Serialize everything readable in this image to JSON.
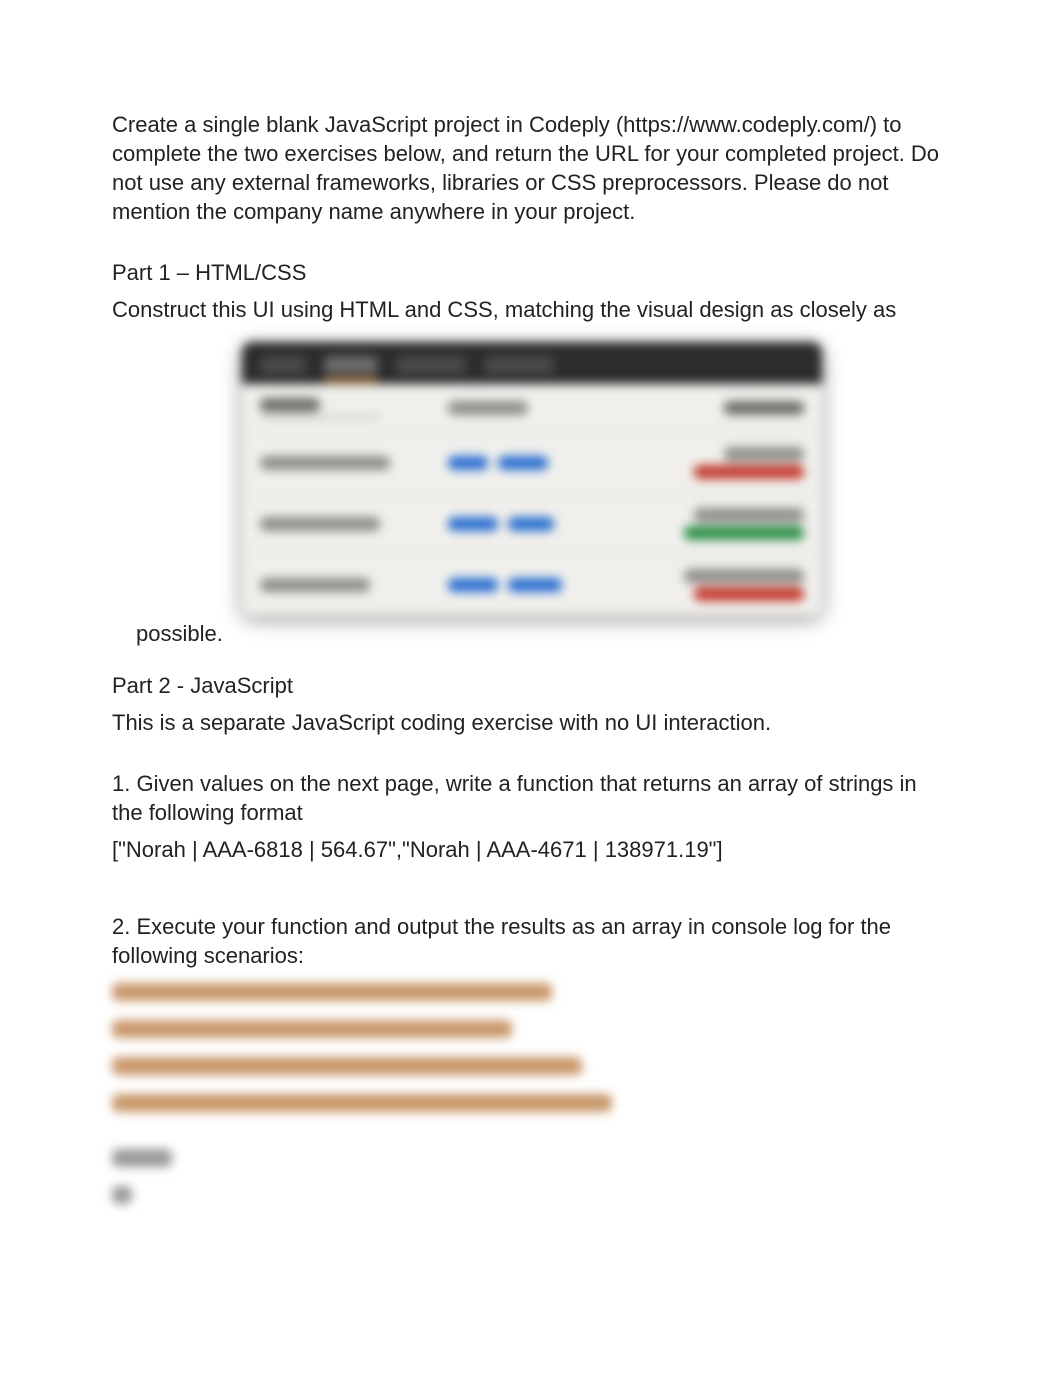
{
  "intro": {
    "p1": "Create a single blank JavaScript project in Codeply (https://www.codeply.com/) to complete the two exercises below, and return the URL for your completed project. Do not use any external frameworks, libraries or CSS preprocessors. Please do not mention the company name anywhere in your project."
  },
  "part1": {
    "heading": "Part 1 – HTML/CSS",
    "body": "Construct this UI using HTML and CSS, matching the visual design as closely as",
    "trailing": "possible."
  },
  "ui_mock": {
    "tabs": [
      "tab1",
      "tab2",
      "tab3",
      "tab4"
    ],
    "active_tab_index": 1,
    "columns": [
      "Name",
      "Account",
      "Balance"
    ],
    "rows": [
      {
        "name": "Norah (blurred)",
        "account_color": "blue",
        "balance_top": "grey",
        "balance_bottom": "red"
      },
      {
        "name": "Row 2 (blurred)",
        "account_color": "blue",
        "balance_top": "grey",
        "balance_bottom": "green"
      },
      {
        "name": "Row 3 (blurred)",
        "account_color": "blue",
        "balance_top": "grey",
        "balance_bottom": "red"
      }
    ]
  },
  "part2": {
    "heading": "Part 2 - JavaScript",
    "intro": "This is a separate JavaScript coding exercise with no UI interaction.",
    "q1": "1. Given values on the next page, write a function that returns an array of strings in the following format",
    "q1_example": "[\"Norah | AAA-6818 | 564.67\",\"Norah | AAA-4671 | 138971.19\"]",
    "q2": "2. Execute your function and output the results as an array in console log for the following scenarios:"
  },
  "locked_lines_widths": [
    440,
    400,
    470,
    500
  ],
  "locked_tail_widths": [
    60,
    20
  ]
}
